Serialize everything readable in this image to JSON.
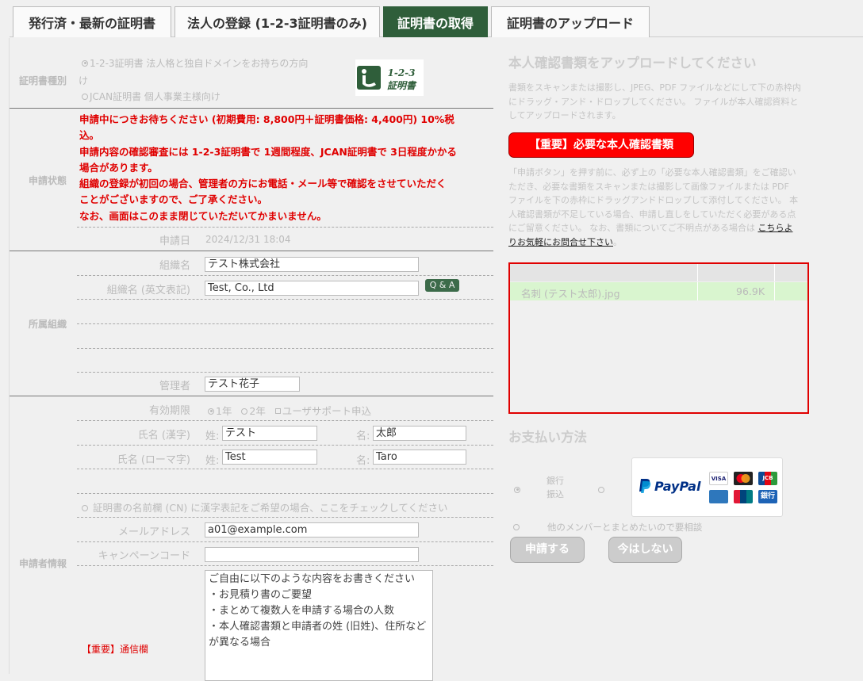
{
  "tabs": [
    {
      "label": "発行済・最新の証明書",
      "active": false
    },
    {
      "label": "法人の登録 (1-2-3証明書のみ)",
      "active": false
    },
    {
      "label": "証明書の取得",
      "active": true
    },
    {
      "label": "証明書のアップロード",
      "active": false
    }
  ],
  "cert_type": {
    "label": "証明書種別",
    "option1": "1-2-3証明書 法人格と独自ドメインをお持ちの方向",
    "option1_cont": "け",
    "option2": "JCAN証明書 個人事業主様向け",
    "logo_line1": "1-2-3",
    "logo_line2": "証明書"
  },
  "status": {
    "label": "申請状態",
    "lines": [
      "申請中につきお待ちください (初期費用: 8,800円＋証明書価格: 4,400円) 10%税",
      "込。",
      "申請内容の確認審査には 1-2-3証明書で 1週間程度、JCAN証明書で 3日程度かかる",
      "場合があります。",
      "組織の登録が初回の場合、管理者の方にお電話・メール等で確認をさせていただく",
      "ことがございますので、ご了承ください。",
      "なお、画面はこのまま閉じていただいてかまいません。"
    ],
    "date_label": "申請日",
    "date_value": "2024/12/31 18:04"
  },
  "organization": {
    "label": "所属組織",
    "name_label": "組織名",
    "name_value": "テスト株式会社",
    "name_en_label": "組織名 (英文表記)",
    "name_en_value": "Test, Co., Ltd",
    "qa_label": "Q & A",
    "admin_label": "管理者",
    "admin_value": "テスト花子"
  },
  "applicant": {
    "label": "申請者情報",
    "validity_label": "有効期限",
    "validity_options": [
      "1年",
      "2年",
      "ユーザサポート申込"
    ],
    "kanji_label": "氏名 (漢字)",
    "roman_label": "氏名 (ローマ字)",
    "sei_label": "姓:",
    "mei_label": "名:",
    "sei_kanji": "テスト",
    "mei_kanji": "太郎",
    "sei_roman": "Test",
    "mei_roman": "Taro",
    "cn_check": "証明書の名前欄 (CN) に漢字表記をご希望の場合、ここをチェックしてください",
    "email_label": "メールアドレス",
    "email_value": "a01@example.com",
    "campaign_label": "キャンペーンコード",
    "campaign_value": "",
    "notes_label": "【重要】通信欄",
    "notes_value": "ご自由に以下のような内容をお書きください\n・お見積り書のご要望\n・まとめて複数人を申請する場合の人数\n・本人確認書類と申請者の姓 (旧姓)、住所など\nが異なる場合"
  },
  "upload": {
    "heading": "本人確認書類をアップロードしてください",
    "desc_lines": [
      "書類をスキャンまたは撮影し、JPEG、PDF ファイルなどにして下の赤枠内",
      "にドラッグ・アンド・ドロップしてください。 ファイルが本人確認資料と",
      "してアップロードされます。"
    ],
    "important_button": "【重要】必要な本人確認書類",
    "note_lines": [
      "「申請ボタン」を押す前に、必ず上の「必要な本人確認書類」をご確認い",
      "ただき、必要な書類をスキャンまたは撮影して画像ファイルまたは PDF",
      "ファイルを下の赤枠にドラッグアンドドロップして添付してください。 本",
      "人確認書類が不足している場合、申請し直しをしていただく必要がある点",
      "にご留意ください。 なお、書類についてご不明点がある場合は"
    ],
    "link_part1": "こちらよ",
    "link_part2": "りお気軽にお問合せ下さい",
    "link_tail": "。",
    "file_name": "名刺 (テスト太郎).jpg",
    "file_size": "96.9K"
  },
  "payment": {
    "heading": "お支払い方法",
    "bank_label_1": "銀行",
    "bank_label_2": "振込",
    "paypal_label": "PayPal",
    "cards": [
      "VISA",
      "MC",
      "JCB",
      "AMEX",
      "UnionPay",
      "銀行"
    ],
    "other_option": "他のメンバーとまとめたいので要相談",
    "apply_button": "申請する",
    "later_button": "今はしない"
  },
  "colors": {
    "active_tab": "#2f5e3a",
    "status_red": "#e00000",
    "important_red": "#ff0000",
    "file_row": "#d9f5cf"
  }
}
